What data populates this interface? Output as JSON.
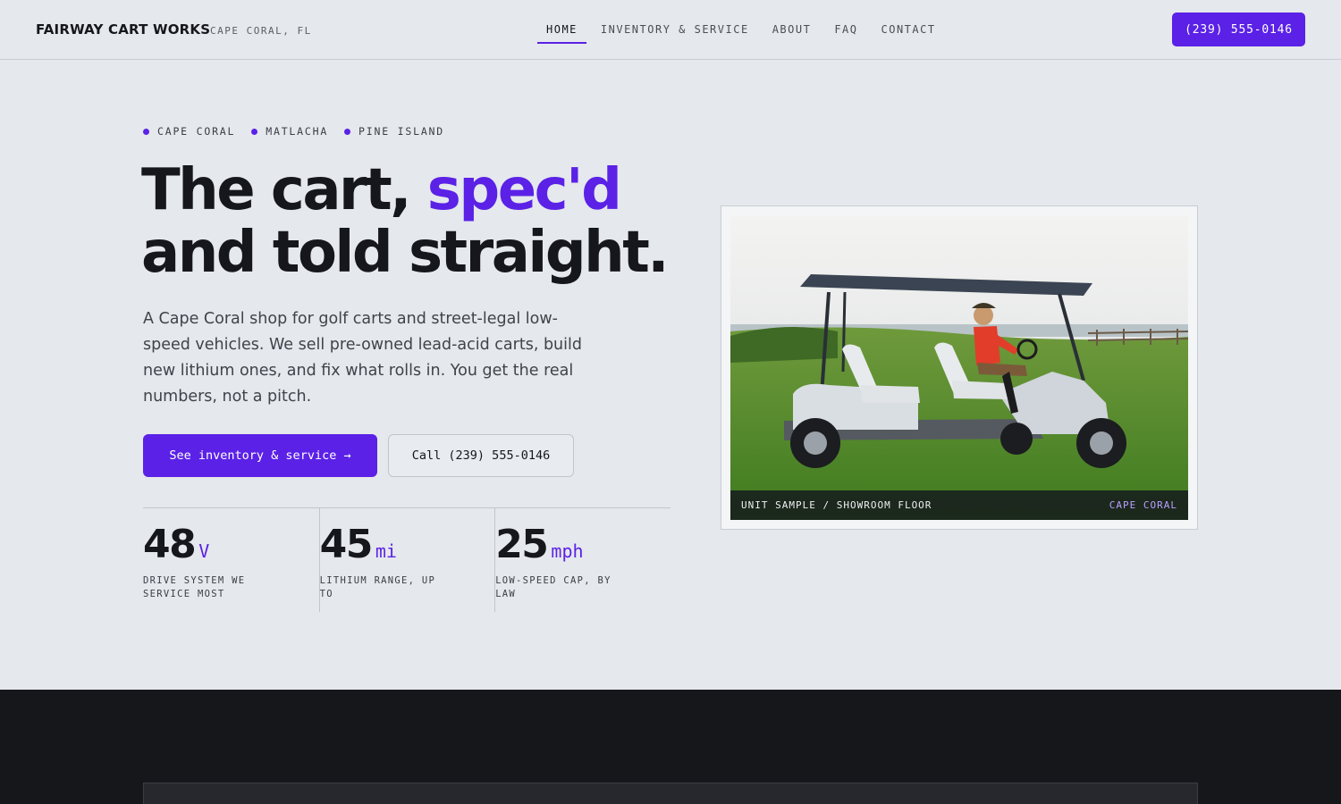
{
  "header": {
    "brand": "FAIRWAY CART WORKS",
    "location": "CAPE CORAL, FL",
    "nav": [
      {
        "label": "HOME",
        "active": true
      },
      {
        "label": "INVENTORY & SERVICE",
        "active": false
      },
      {
        "label": "ABOUT",
        "active": false
      },
      {
        "label": "FAQ",
        "active": false
      },
      {
        "label": "CONTACT",
        "active": false
      }
    ],
    "phone": "(239) 555-0146"
  },
  "hero": {
    "locations": [
      "CAPE CORAL",
      "MATLACHA",
      "PINE ISLAND"
    ],
    "headline_line1_pre": "The cart, ",
    "headline_line1_accent": "spec'd",
    "headline_line2": "and told straight.",
    "lede": "A Cape Coral shop for golf carts and street-legal low-speed vehicles. We sell pre-owned lead-acid carts, build new lithium ones, and fix what rolls in. You get the real numbers, not a pitch.",
    "cta_primary": "See inventory & service →",
    "cta_secondary": "Call (239) 555-0146",
    "stats": [
      {
        "value": "48",
        "unit": "V",
        "label": "DRIVE SYSTEM WE SERVICE MOST"
      },
      {
        "value": "45",
        "unit": "mi",
        "label": "LITHIUM RANGE, UP TO"
      },
      {
        "value": "25",
        "unit": "mph",
        "label": "LOW-SPEED CAP, BY LAW"
      }
    ]
  },
  "photo": {
    "caption_left": "UNIT SAMPLE / SHOWROOM FLOOR",
    "caption_right": "CAPE CORAL"
  },
  "colors": {
    "accent": "#5b21e6",
    "background": "#e5e8ec",
    "dark_section": "#15171b"
  }
}
